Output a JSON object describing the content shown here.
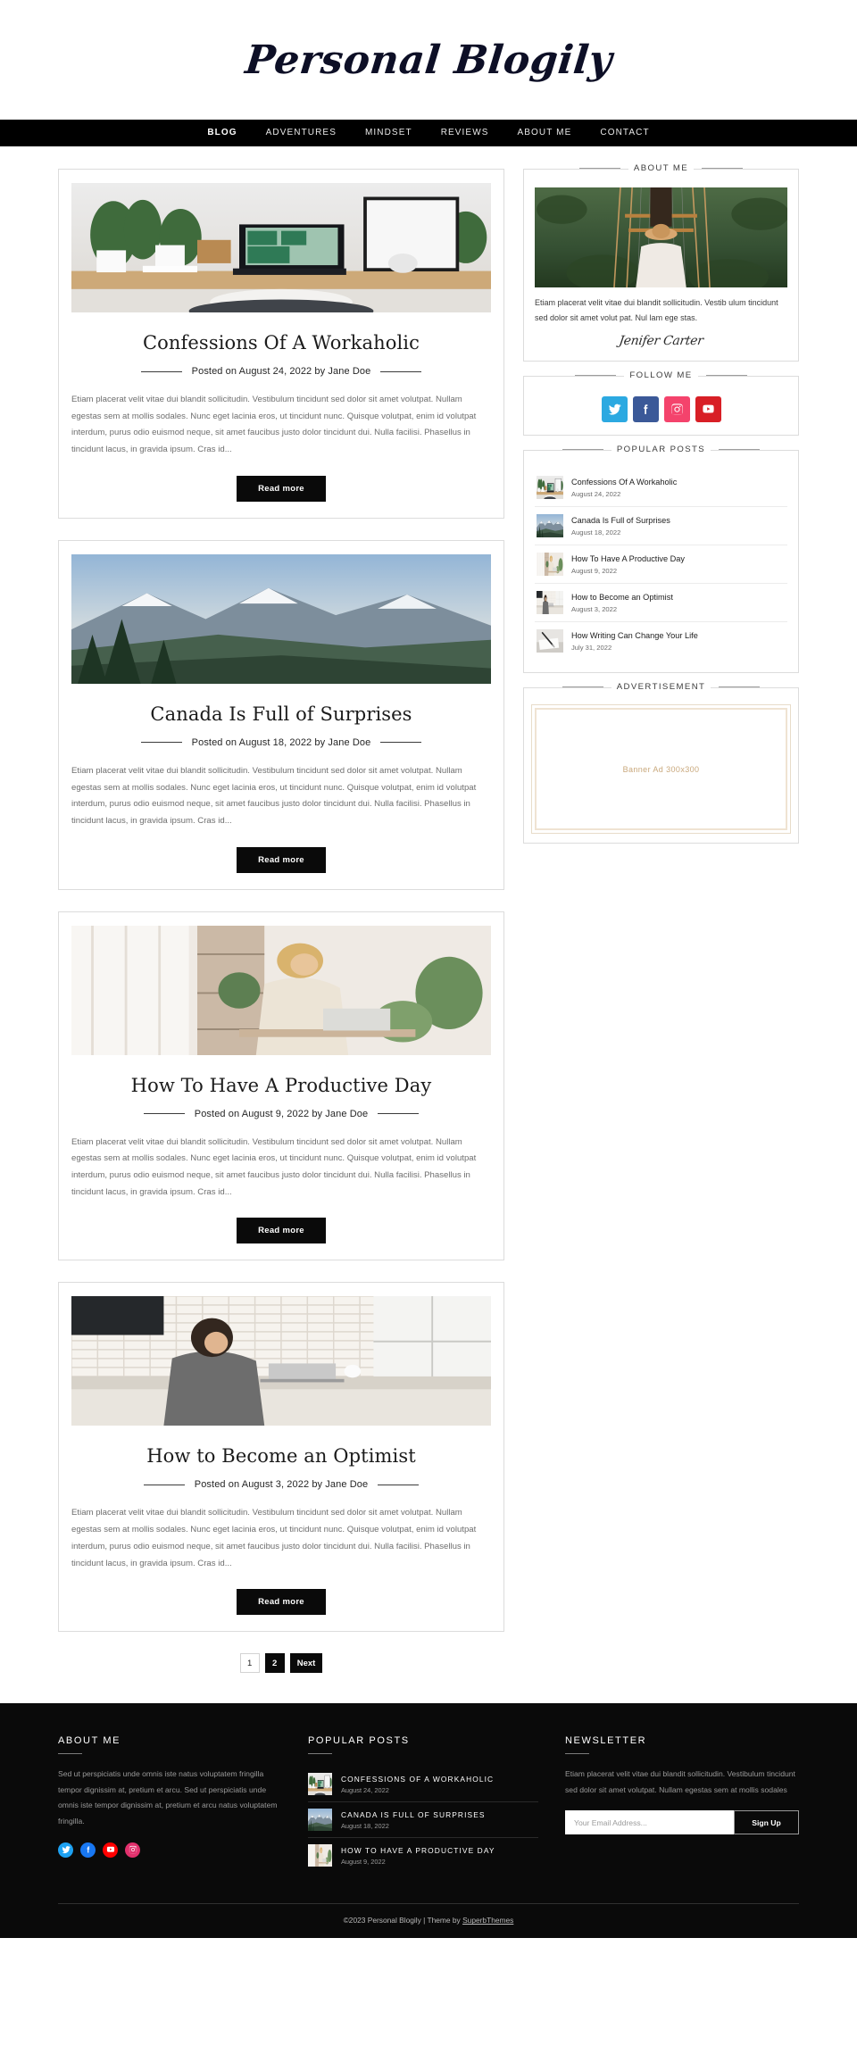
{
  "header": {
    "site_title": "Personal Blogily"
  },
  "nav": {
    "items": [
      {
        "label": "BLOG",
        "active": true
      },
      {
        "label": "ADVENTURES",
        "active": false
      },
      {
        "label": "MINDSET",
        "active": false
      },
      {
        "label": "REVIEWS",
        "active": false
      },
      {
        "label": "ABOUT ME",
        "active": false
      },
      {
        "label": "CONTACT",
        "active": false
      }
    ]
  },
  "posts": [
    {
      "title": "Confessions Of A Workaholic",
      "meta": "Posted on August 24, 2022 by Jane Doe",
      "excerpt": "Etiam placerat velit vitae dui blandit sollicitudin. Vestibulum tincidunt sed dolor sit amet volutpat. Nullam egestas sem at mollis sodales. Nunc eget lacinia eros, ut tincidunt nunc. Quisque volutpat, enim id volutpat interdum, purus odio euismod neque, sit amet faucibus justo dolor tincidunt dui. Nulla facilisi. Phasellus in tincidunt lacus, in gravida ipsum. Cras id...",
      "read_more": "Read more",
      "image": "desk-workspace-plants-laptop"
    },
    {
      "title": "Canada Is Full of Surprises",
      "meta": "Posted on August 18, 2022 by Jane Doe",
      "excerpt": "Etiam placerat velit vitae dui blandit sollicitudin. Vestibulum tincidunt sed dolor sit amet volutpat. Nullam egestas sem at mollis sodales. Nunc eget lacinia eros, ut tincidunt nunc. Quisque volutpat, enim id volutpat interdum, purus odio euismod neque, sit amet faucibus justo dolor tincidunt dui. Nulla facilisi. Phasellus in tincidunt lacus, in gravida ipsum. Cras id...",
      "read_more": "Read more",
      "image": "mountain-valley-landscape"
    },
    {
      "title": "How To Have A Productive Day",
      "meta": "Posted on August 9, 2022 by Jane Doe",
      "excerpt": "Etiam placerat velit vitae dui blandit sollicitudin. Vestibulum tincidunt sed dolor sit amet volutpat. Nullam egestas sem at mollis sodales. Nunc eget lacinia eros, ut tincidunt nunc. Quisque volutpat, enim id volutpat interdum, purus odio euismod neque, sit amet faucibus justo dolor tincidunt dui. Nulla facilisi. Phasellus in tincidunt lacus, in gravida ipsum. Cras id...",
      "read_more": "Read more",
      "image": "woman-at-desk-with-plants"
    },
    {
      "title": "How to Become an Optimist",
      "meta": "Posted on August 3, 2022 by Jane Doe",
      "excerpt": "Etiam placerat velit vitae dui blandit sollicitudin. Vestibulum tincidunt sed dolor sit amet volutpat. Nullam egestas sem at mollis sodales. Nunc eget lacinia eros, ut tincidunt nunc. Quisque volutpat, enim id volutpat interdum, purus odio euismod neque, sit amet faucibus justo dolor tincidunt dui. Nulla facilisi. Phasellus in tincidunt lacus, in gravida ipsum. Cras id...",
      "read_more": "Read more",
      "image": "woman-in-kitchen-with-laptop"
    }
  ],
  "pagination": {
    "pages": [
      "1",
      "2"
    ],
    "next_label": "Next",
    "current": "1"
  },
  "sidebar": {
    "about": {
      "title": "ABOUT ME",
      "text": "Etiam placerat velit vitae dui blandit sollicitudin. Vestib ulum tincidunt sed dolor sit amet volut pat. Nul lam ege stas.",
      "signature": "Jenifer Carter"
    },
    "follow": {
      "title": "FOLLOW ME",
      "socials": [
        {
          "name": "twitter",
          "color": "#2ca9e1"
        },
        {
          "name": "facebook",
          "color": "#3b5998"
        },
        {
          "name": "instagram",
          "color": "#f4436c"
        },
        {
          "name": "youtube",
          "color": "#d81f26"
        }
      ]
    },
    "popular": {
      "title": "POPULAR POSTS",
      "items": [
        {
          "title": "Confessions Of A Workaholic",
          "date": "August 24, 2022",
          "image": "desk-workspace-plants-laptop"
        },
        {
          "title": "Canada Is Full of Surprises",
          "date": "August 18, 2022",
          "image": "mountain-valley-landscape"
        },
        {
          "title": "How To Have A Productive Day",
          "date": "August 9, 2022",
          "image": "woman-at-desk-with-plants"
        },
        {
          "title": "How to Become an Optimist",
          "date": "August 3, 2022",
          "image": "woman-in-kitchen-with-laptop"
        },
        {
          "title": "How Writing Can Change Your Life",
          "date": "July 31, 2022",
          "image": "writing-desk-pen-paper"
        }
      ]
    },
    "ad": {
      "title": "ADVERTISEMENT",
      "label": "Banner Ad 300x300"
    }
  },
  "footer": {
    "about": {
      "heading": "ABOUT ME",
      "text": "Sed ut perspiciatis unde omnis iste natus voluptatem fringilla tempor dignissim at, pretium et arcu. Sed ut perspiciatis unde omnis iste tempor dignissim at, pretium et arcu natus voluptatem fringilla.",
      "socials": [
        {
          "name": "twitter",
          "color": "#1da1f2"
        },
        {
          "name": "facebook",
          "color": "#1877f2"
        },
        {
          "name": "youtube",
          "color": "#ff0000"
        },
        {
          "name": "instagram",
          "color": "#e1306c"
        }
      ]
    },
    "popular": {
      "heading": "POPULAR POSTS",
      "items": [
        {
          "title": "CONFESSIONS OF A WORKAHOLIC",
          "date": "August 24, 2022",
          "image": "desk-workspace-plants-laptop"
        },
        {
          "title": "CANADA IS FULL OF SURPRISES",
          "date": "August 18, 2022",
          "image": "mountain-valley-landscape"
        },
        {
          "title": "HOW TO HAVE A PRODUCTIVE DAY",
          "date": "August 9, 2022",
          "image": "woman-at-desk-with-plants"
        }
      ]
    },
    "newsletter": {
      "heading": "NEWSLETTER",
      "text": "Etiam placerat velit vitae dui blandit sollicitudin. Vestibulum tincidunt sed dolor sit amet volutpat. Nullam egestas sem at mollis sodales",
      "placeholder": "Your Email Address...",
      "button": "Sign Up"
    },
    "copyright_prefix": "©2023 Personal Blogily | Theme by ",
    "copyright_link": "SuperbThemes"
  },
  "colors": {
    "accent": "#000000",
    "ad_border": "#efe3d2",
    "ad_text": "#c9a87c"
  }
}
